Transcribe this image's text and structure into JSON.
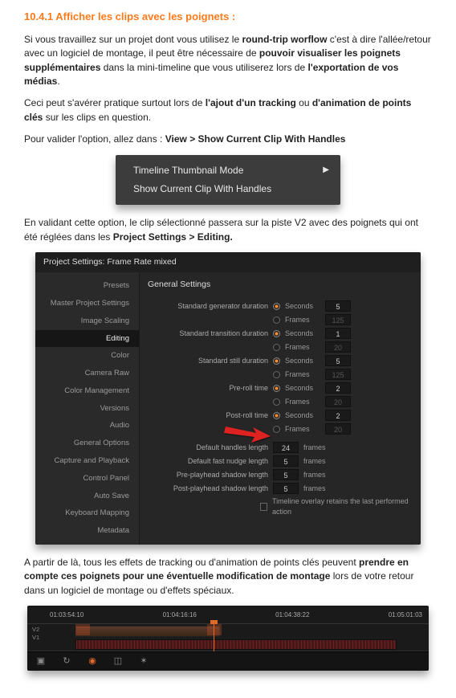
{
  "heading": "10.4.1 Afficher les clips avec les poignets :",
  "p1": {
    "pre": "Si vous travaillez sur un projet dont vous utilisez le ",
    "b1": "round-trip worflow ",
    "mid1": "c'est à dire l'allée/retour avec un logiciel de montage, il peut être nécessaire de ",
    "b2": "pouvoir visualiser les poignets supplémentaires ",
    "mid2": "dans la mini-timeline que vous utiliserez lors de ",
    "b3": "l'exportation de vos médias",
    "end": "."
  },
  "p2": {
    "pre": "Ceci peut s'avérer pratique surtout lors de ",
    "b1": "l'ajout d'un tracking ",
    "mid": "ou ",
    "b2": "d'animation de points clés ",
    "end": "sur les clips en question."
  },
  "p3": {
    "pre": "Pour valider l'option, allez dans : ",
    "b": "View > Show Current Clip With Handles"
  },
  "menu": {
    "item1": "Timeline Thumbnail Mode",
    "item2": "Show Current Clip With Handles"
  },
  "p4": {
    "pre": "En validant cette option, le clip sélectionné passera sur la piste V2 avec des poignets qui ont été réglées dans les ",
    "b": "Project Settings > Editing."
  },
  "settings": {
    "title": "Project Settings: Frame Rate mixed",
    "sidebar": [
      "Presets",
      "Master Project Settings",
      "Image Scaling",
      "Editing",
      "Color",
      "Camera Raw",
      "Color Management",
      "Versions",
      "Audio",
      "General Options",
      "Capture and Playback",
      "Control Panel",
      "Auto Save",
      "Keyboard Mapping",
      "Metadata"
    ],
    "active_index": 3,
    "section": "General Settings",
    "rows": {
      "std_gen": {
        "label": "Standard generator duration",
        "seconds": "5",
        "frames": "125"
      },
      "std_trans": {
        "label": "Standard transition duration",
        "seconds": "1",
        "frames": "20"
      },
      "std_still": {
        "label": "Standard still duration",
        "seconds": "5",
        "frames": "125"
      },
      "preroll": {
        "label": "Pre-roll time",
        "seconds": "2",
        "frames": "20"
      },
      "postroll": {
        "label": "Post-roll time",
        "seconds": "2",
        "frames": "20"
      },
      "def_handles": {
        "label": "Default handles length",
        "value": "24",
        "unit": "frames"
      },
      "fast_nudge": {
        "label": "Default fast nudge length",
        "value": "5",
        "unit": "frames"
      },
      "pre_shadow": {
        "label": "Pre-playhead shadow length",
        "value": "5",
        "unit": "frames"
      },
      "post_shadow": {
        "label": "Post-playhead shadow length",
        "value": "5",
        "unit": "frames"
      },
      "overlay_chk": "Timeline overlay retains the last performed action"
    },
    "units": {
      "seconds": "Seconds",
      "frames": "Frames"
    }
  },
  "p5": {
    "pre": "A partir de là, tous les effets de tracking ou d'animation de points clés peuvent ",
    "b": "prendre en compte ces poignets pour une éventuelle modification de montage ",
    "end": "lors de votre retour dans un logiciel de montage ou d'effets spéciaux."
  },
  "timeline": {
    "timecodes": [
      "01:03:54:10",
      "01:04:16:16",
      "01:04:38:22",
      "01:05:01:03"
    ],
    "tracks": {
      "v2": "V2",
      "v1": "V1"
    }
  }
}
